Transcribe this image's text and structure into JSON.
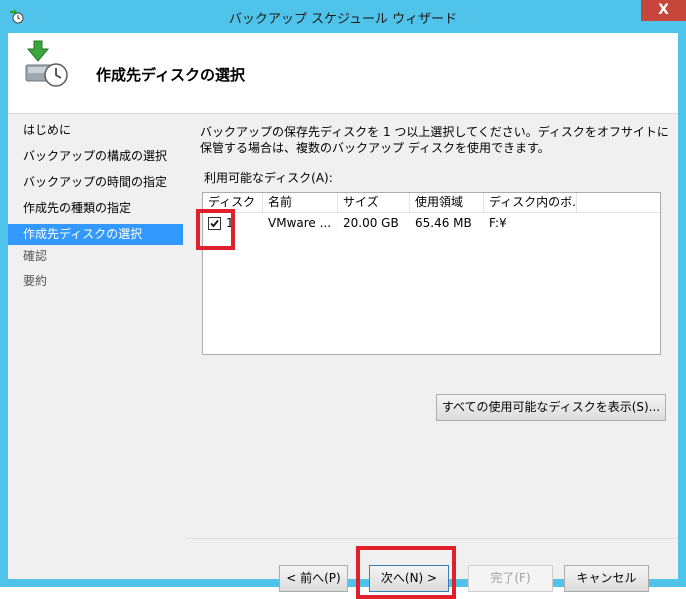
{
  "window": {
    "title": "バックアップ スケジュール ウィザード",
    "close_label": "X"
  },
  "header": {
    "page_title": "作成先ディスクの選択"
  },
  "nav": {
    "items": [
      {
        "label": "はじめに",
        "state": "visited"
      },
      {
        "label": "バックアップの構成の選択",
        "state": "visited"
      },
      {
        "label": "バックアップの時間の指定",
        "state": "visited"
      },
      {
        "label": "作成先の種類の指定",
        "state": "visited"
      },
      {
        "label": "作成先ディスクの選択",
        "state": "selected"
      },
      {
        "label": "確認",
        "state": "pending"
      },
      {
        "label": "要約",
        "state": "pending"
      }
    ]
  },
  "content": {
    "description": "バックアップの保存先ディスクを 1 つ以上選択してください。ディスクをオフサイトに保管する場合は、複数のバックアップ ディスクを使用できます。",
    "available_label": "利用可能なディスク(A):",
    "columns": [
      "ディスク",
      "名前",
      "サイズ",
      "使用領域",
      "ディスク内のボ..."
    ],
    "rows": [
      {
        "checked": true,
        "disk": "1",
        "name": "VMware ...",
        "size": "20.00 GB",
        "used": "65.46 MB",
        "volumes": "F:¥"
      }
    ],
    "show_all_button": "すべての使用可能なディスクを表示(S)..."
  },
  "buttons": {
    "back": "< 前へ(P)",
    "next": "次へ(N) >",
    "finish": "完了(F)",
    "cancel": "キャンセル"
  },
  "colors": {
    "title_bar": "#4fc3ea",
    "selection": "#3399ff",
    "highlight_box": "#e0202a",
    "close_button": "#c7463b"
  }
}
